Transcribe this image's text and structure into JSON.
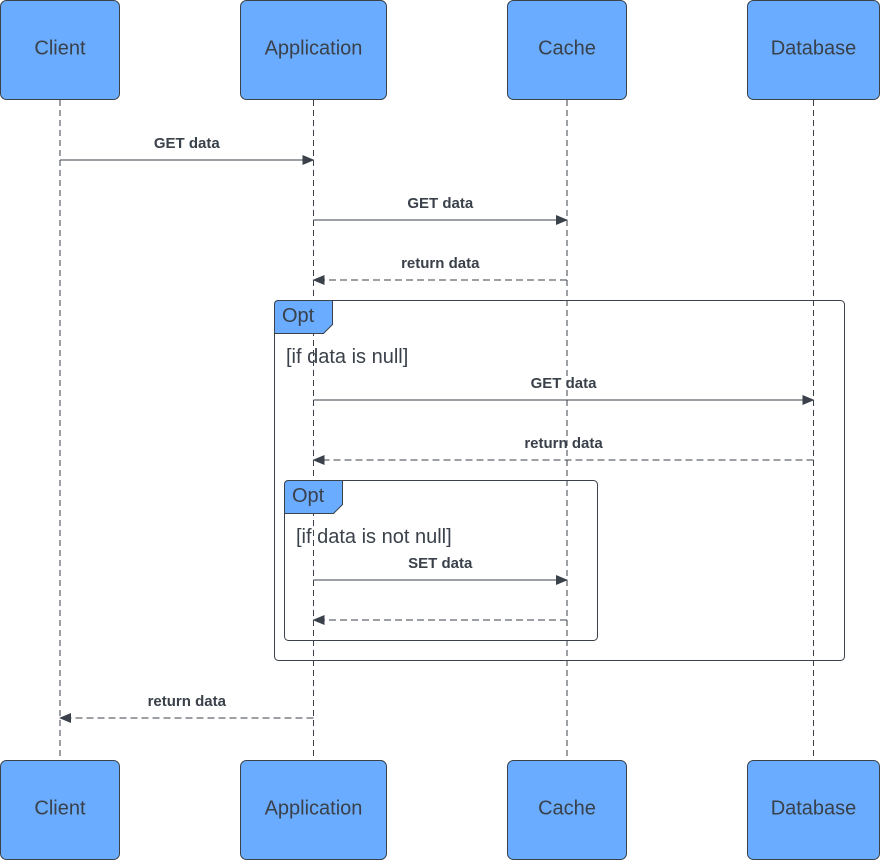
{
  "participants": [
    {
      "name": "Client"
    },
    {
      "name": "Application"
    },
    {
      "name": "Cache"
    },
    {
      "name": "Database"
    }
  ],
  "messages": [
    {
      "from": "Client",
      "to": "Application",
      "label": "GET data",
      "style": "solid"
    },
    {
      "from": "Application",
      "to": "Cache",
      "label": "GET data",
      "style": "solid"
    },
    {
      "from": "Cache",
      "to": "Application",
      "label": "return data",
      "style": "dashed"
    },
    {
      "from": "Application",
      "to": "Database",
      "label": "GET data",
      "style": "solid"
    },
    {
      "from": "Database",
      "to": "Application",
      "label": "return data",
      "style": "dashed"
    },
    {
      "from": "Application",
      "to": "Cache",
      "label": "SET data",
      "style": "solid"
    },
    {
      "from": "Cache",
      "to": "Application",
      "label": "",
      "style": "dashed"
    },
    {
      "from": "Application",
      "to": "Client",
      "label": "return data",
      "style": "dashed"
    }
  ],
  "fragments": [
    {
      "operator": "Opt",
      "guard": "[if data is null]"
    },
    {
      "operator": "Opt",
      "guard": "[if data is not null]"
    }
  ],
  "colors": {
    "participant_fill": "#6aacff",
    "line": "#3a414a"
  }
}
